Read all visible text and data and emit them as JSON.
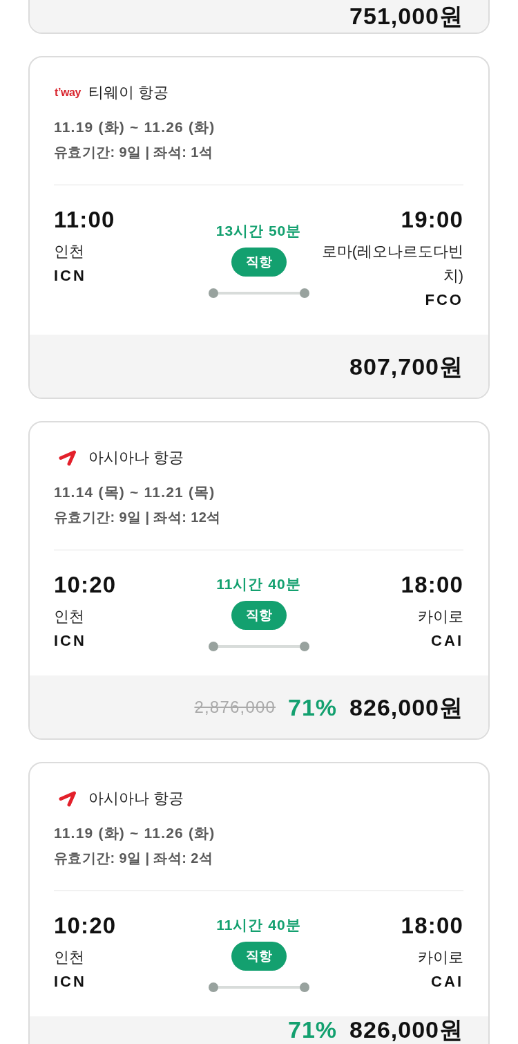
{
  "flights": [
    {
      "price": "751,000원"
    },
    {
      "airline": {
        "name": "티웨이 항공",
        "logo": {
          "kind": "wordmark",
          "text": "t’way"
        }
      },
      "dates": "11.19 (화) ~ 11.26 (화)",
      "details": "유효기간: 9일 | 좌석: 1석",
      "departure": {
        "time": "11:00",
        "city": "인천",
        "code": "ICN"
      },
      "duration": "13시간 50분",
      "badge": "직항",
      "arrival": {
        "time": "19:00",
        "city": "로마(레오나르도다빈치)",
        "code": "FCO"
      },
      "price": "807,700원"
    },
    {
      "airline": {
        "name": "아시아나 항공",
        "logo": {
          "kind": "stroke"
        }
      },
      "dates": "11.14 (목) ~ 11.21 (목)",
      "details": "유효기간: 9일 | 좌석: 12석",
      "departure": {
        "time": "10:20",
        "city": "인천",
        "code": "ICN"
      },
      "duration": "11시간 40분",
      "badge": "직항",
      "arrival": {
        "time": "18:00",
        "city": "카이로",
        "code": "CAI"
      },
      "original_price": "2,876,000",
      "discount": "71%",
      "price": "826,000원"
    },
    {
      "airline": {
        "name": "아시아나 항공",
        "logo": {
          "kind": "stroke"
        }
      },
      "dates": "11.19 (화) ~ 11.26 (화)",
      "details": "유효기간: 9일 | 좌석: 2석",
      "departure": {
        "time": "10:20",
        "city": "인천",
        "code": "ICN"
      },
      "duration": "11시간 40분",
      "badge": "직항",
      "arrival": {
        "time": "18:00",
        "city": "카이로",
        "code": "CAI"
      },
      "discount": "71%",
      "price": "826,000원"
    }
  ]
}
